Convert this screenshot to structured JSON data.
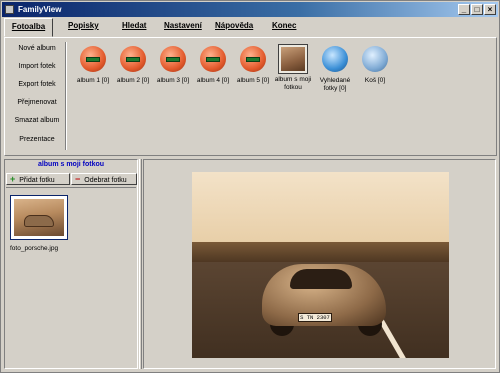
{
  "window": {
    "title": "FamilyView",
    "minimize": "_",
    "maximize": "□",
    "close": "×"
  },
  "menu": {
    "tabs": [
      {
        "label": "Fotoalba",
        "active": true
      },
      {
        "label": "Popisky"
      },
      {
        "label": "Hledat"
      },
      {
        "label": "Nastavení"
      },
      {
        "label": "Nápověda"
      },
      {
        "label": "Konec"
      }
    ]
  },
  "actions": [
    "Nové album",
    "Import fotek",
    "Export fotek",
    "Přejmenovat",
    "Smazat album",
    "Prezentace"
  ],
  "albums": [
    {
      "label": "album 1 [0]",
      "icon": "album-icon"
    },
    {
      "label": "album 2 [0]",
      "icon": "album-icon"
    },
    {
      "label": "album 3 [0]",
      "icon": "album-icon"
    },
    {
      "label": "album 4 [0]",
      "icon": "album-icon"
    },
    {
      "label": "album 5 [0]",
      "icon": "album-icon"
    },
    {
      "label": "album s moji fotkou",
      "icon": "photo-thumbnail",
      "selected": true
    },
    {
      "label": "Vyhledané fotky [0]",
      "icon": "search-icon"
    },
    {
      "label": "Koš [0]",
      "icon": "trash-icon"
    }
  ],
  "leftpane": {
    "heading": "album s moji fotkou",
    "add_label": "Přidat fotku",
    "remove_label": "Odebrat fotku",
    "photos": [
      {
        "caption": "foto_porsche.jpg"
      }
    ]
  },
  "viewer": {
    "plate_text": "S TN 2307"
  },
  "colors": {
    "titlebar_start": "#0a246a",
    "heading_text": "#0000c0",
    "face": "#d4d0c8",
    "add_icon": "#1f8a1f",
    "remove_icon": "#c00000"
  }
}
